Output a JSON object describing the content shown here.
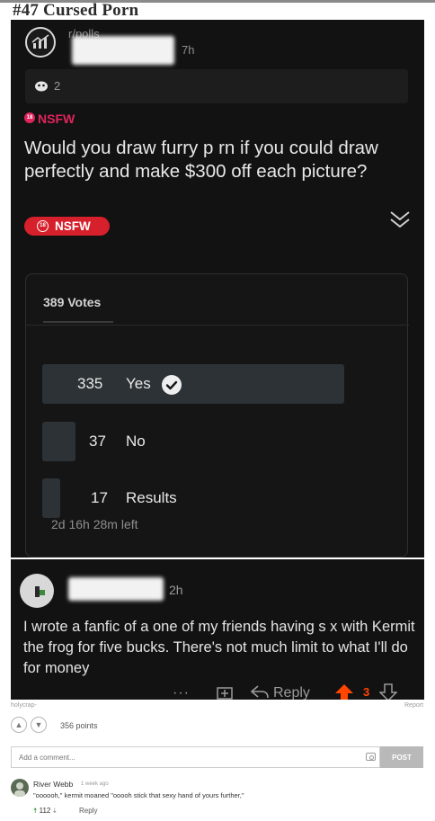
{
  "page": {
    "title": "#47 Cursed Porn"
  },
  "poll_post": {
    "subreddit": "r/polls",
    "time": "7h",
    "award_count": "2",
    "nsfw_tag": "NSFW",
    "question": "Would you draw furry p  rn if you could draw perfectly and make $300 off each picture?",
    "nsfw_badge": "NSFW",
    "total_votes": "389 Votes",
    "options": [
      {
        "count": "335",
        "label": "Yes",
        "fraction": 0.861,
        "selected": true
      },
      {
        "count": "37",
        "label": "No",
        "fraction": 0.095,
        "selected": false
      },
      {
        "count": "17",
        "label": "Results",
        "fraction": 0.044,
        "selected": false
      }
    ],
    "time_left": "2d 16h 28m left"
  },
  "comment_post": {
    "time": "2h",
    "text": "I wrote a fanfic of a one of my friends having s x with Kermit the frog for five bucks. There's not much limit to what I'll do for money",
    "reply_label": "Reply",
    "score": "3",
    "more_icon": "ellipsis-icon"
  },
  "site": {
    "poster": "holycrap-",
    "report_label": "Report",
    "points": "356 points",
    "comment_placeholder": "Add a comment...",
    "post_label": "POST",
    "comment": {
      "author": "River Webb",
      "time": "1 week ago",
      "text": "\"oooooh,\" kermit moaned \"ooooh stick that sexy hand of yours further,\"",
      "score": "112",
      "reply_label": "Reply"
    }
  },
  "colors": {
    "nsfw": "#e0245e",
    "upvote_orange": "#ff4500",
    "dark_bg": "#121212",
    "upvote_green": "#3a9b3a"
  }
}
